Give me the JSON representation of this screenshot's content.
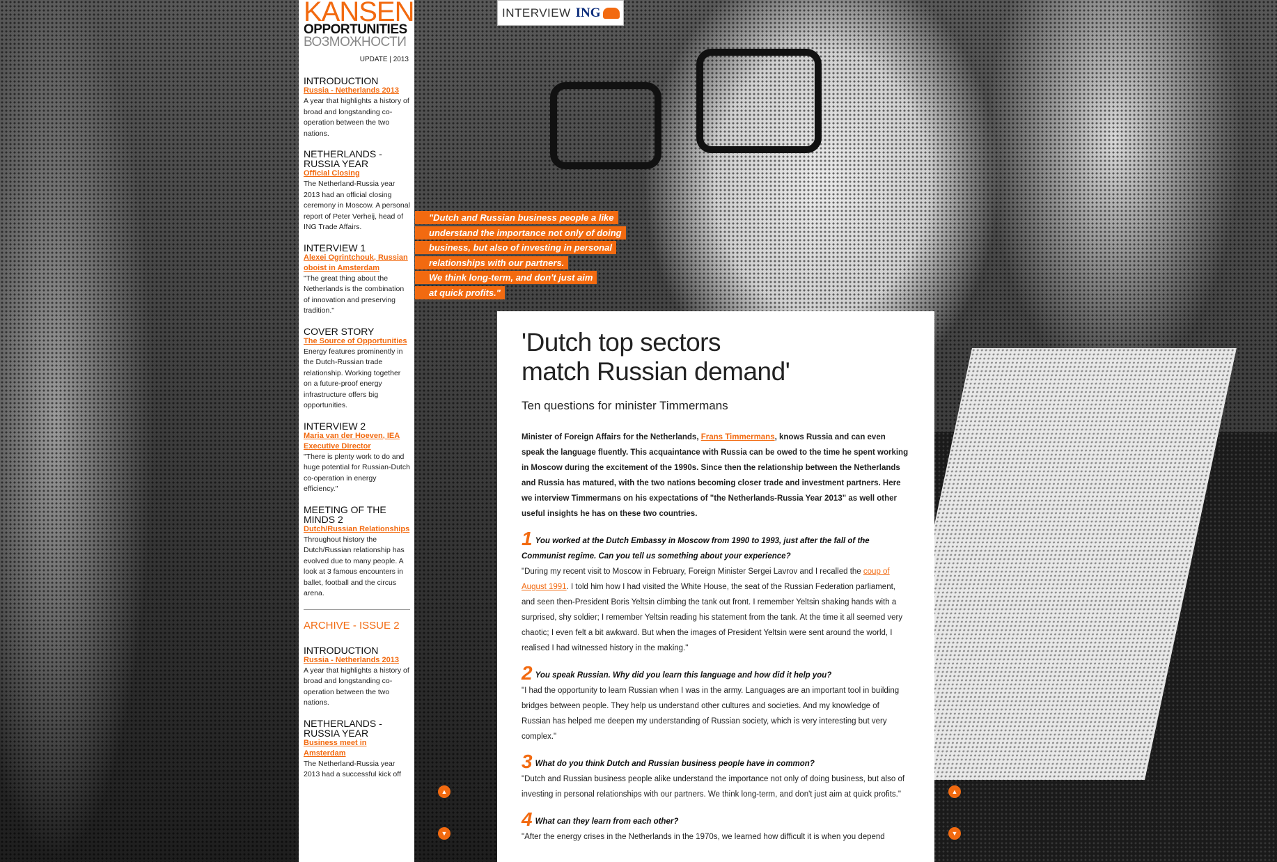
{
  "logo": {
    "line1": "KANSEN",
    "line2": "OPPORTUNITIES",
    "line3": "ВОЗМОЖНОСТИ"
  },
  "update": "UPDATE | 2013",
  "sidebar": {
    "sections": [
      {
        "heading": "INTRODUCTION",
        "link": "Russia - Netherlands 2013",
        "text": "A year that highlights a history of broad and longstanding co-operation between the two nations."
      },
      {
        "heading": "NETHERLANDS - RUSSIA YEAR",
        "link": "Official Closing",
        "text": "The Netherland-Russia year 2013 had an official closing ceremony in Moscow. A personal report of Peter Verheij, head of ING Trade Affairs."
      },
      {
        "heading": "INTERVIEW 1",
        "link": "Alexei Ogrintchouk, Russian oboist in Amsterdam",
        "text": "\"The great thing about the Netherlands is the combination of innovation and preserving tradition.\""
      },
      {
        "heading": "COVER STORY",
        "link": "The Source of Opportunities",
        "text": "Energy features prominently in the Dutch-Russian trade relationship. Working together on a future-proof energy infrastructure offers big opportunities."
      },
      {
        "heading": "INTERVIEW 2",
        "link": "Maria van der Hoeven, IEA Executive Director",
        "text": "\"There is plenty work to do and huge potential for Russian-Dutch co-operation in energy efficiency.\""
      },
      {
        "heading": "MEETING OF THE MINDS 2",
        "link": "Dutch/Russian Relationships",
        "text": "Throughout history the Dutch/Russian relationship has evolved due to many people. A look at 3 famous encounters in ballet, football and the circus arena."
      }
    ],
    "archive_title": "ARCHIVE - ISSUE 2",
    "archive_sections": [
      {
        "heading": "INTRODUCTION",
        "link": "Russia - Netherlands 2013",
        "text": "A year that highlights a history of broad and longstanding co-operation between the two nations."
      },
      {
        "heading": "NETHERLANDS - RUSSIA YEAR",
        "link": "Business meet in Amsterdam",
        "text": "The Netherland-Russia year 2013 had a successful kick off"
      }
    ]
  },
  "badge": {
    "label": "INTERVIEW",
    "brand": "ING"
  },
  "quote": {
    "lines": [
      "\"Dutch and Russian business people a like",
      "understand the importance not only of doing",
      "business, but also of investing in personal",
      "relationships with our partners.",
      "We think long-term, and don't just aim",
      "at quick profits.\""
    ]
  },
  "article": {
    "title_line1": "'Dutch top sectors",
    "title_line2": "match Russian demand'",
    "subtitle": "Ten questions for minister Timmermans",
    "intro_before": "Minister of Foreign Affairs for the Netherlands, ",
    "intro_link": "Frans Timmermans",
    "intro_after": ", knows Russia and can even speak the language fluently. This acquaintance with Russia can be owed to the time he spent working in Moscow during the excitement of the 1990s. Since then the relationship between the Netherlands and Russia has matured, with the two nations becoming closer trade and investment partners. Here we interview Timmermans on his expectations of \"the Netherlands-Russia Year 2013\" as well other useful insights he has on these two countries.",
    "questions": [
      {
        "num": "1",
        "question": "You worked at the Dutch Embassy in Moscow from 1990 to 1993, just after the fall of the Communist regime. Can you tell us something about your experience?",
        "answer_before": "\"During my recent visit to Moscow in February, Foreign Minister Sergei Lavrov and I recalled the ",
        "answer_link": "coup of August 1991",
        "answer_after": ". I told him how I had visited the White House, the seat of the Russian Federation parliament, and seen then-President Boris Yeltsin climbing the tank out front. I remember Yeltsin shaking hands with a surprised, shy soldier; I remember Yeltsin reading his statement from the tank. At the time it all seemed very chaotic; I even felt a bit awkward. But when the images of President Yeltsin were sent around the world, I realised I had witnessed history in the making.\""
      },
      {
        "num": "2",
        "question": "You speak Russian. Why did you learn this language and how did it help you?",
        "answer_before": "\"I had the opportunity to learn Russian when I was in the army. Languages are an important tool in building bridges between people. They help us understand other cultures and societies. And my knowledge of Russian has helped me deepen my understanding of Russian society, which is very interesting but very complex.\"",
        "answer_link": "",
        "answer_after": ""
      },
      {
        "num": "3",
        "question": "What do you think Dutch and Russian business people have in common?",
        "answer_before": "\"Dutch and Russian business people alike understand the importance not only of doing business, but also of investing in personal relationships with our partners. We think long-term, and don't just aim at quick profits.\"",
        "answer_link": "",
        "answer_after": ""
      },
      {
        "num": "4",
        "question": "What can they learn from each other?",
        "answer_before": "\"After the energy crises in the Netherlands in the 1970s, we learned how difficult it is when you depend",
        "answer_link": "",
        "answer_after": ""
      }
    ]
  },
  "scroll": {
    "up": "▲",
    "down": "▼"
  },
  "colors": {
    "accent": "#f26a10",
    "brand_blue": "#0a2b7a"
  }
}
